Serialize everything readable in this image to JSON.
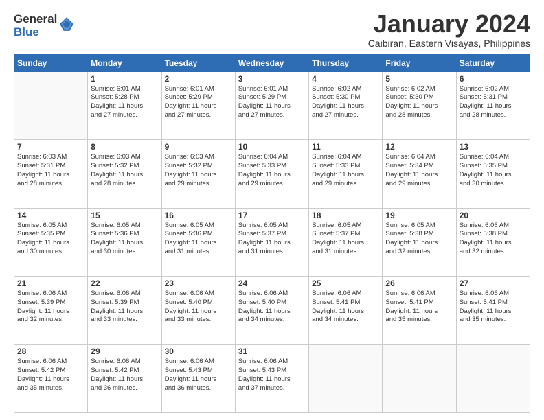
{
  "logo": {
    "general": "General",
    "blue": "Blue"
  },
  "title": "January 2024",
  "subtitle": "Caibiran, Eastern Visayas, Philippines",
  "days_header": [
    "Sunday",
    "Monday",
    "Tuesday",
    "Wednesday",
    "Thursday",
    "Friday",
    "Saturday"
  ],
  "weeks": [
    [
      {
        "day": "",
        "info": ""
      },
      {
        "day": "1",
        "info": "Sunrise: 6:01 AM\nSunset: 5:28 PM\nDaylight: 11 hours\nand 27 minutes."
      },
      {
        "day": "2",
        "info": "Sunrise: 6:01 AM\nSunset: 5:29 PM\nDaylight: 11 hours\nand 27 minutes."
      },
      {
        "day": "3",
        "info": "Sunrise: 6:01 AM\nSunset: 5:29 PM\nDaylight: 11 hours\nand 27 minutes."
      },
      {
        "day": "4",
        "info": "Sunrise: 6:02 AM\nSunset: 5:30 PM\nDaylight: 11 hours\nand 27 minutes."
      },
      {
        "day": "5",
        "info": "Sunrise: 6:02 AM\nSunset: 5:30 PM\nDaylight: 11 hours\nand 28 minutes."
      },
      {
        "day": "6",
        "info": "Sunrise: 6:02 AM\nSunset: 5:31 PM\nDaylight: 11 hours\nand 28 minutes."
      }
    ],
    [
      {
        "day": "7",
        "info": "Sunrise: 6:03 AM\nSunset: 5:31 PM\nDaylight: 11 hours\nand 28 minutes."
      },
      {
        "day": "8",
        "info": "Sunrise: 6:03 AM\nSunset: 5:32 PM\nDaylight: 11 hours\nand 28 minutes."
      },
      {
        "day": "9",
        "info": "Sunrise: 6:03 AM\nSunset: 5:32 PM\nDaylight: 11 hours\nand 29 minutes."
      },
      {
        "day": "10",
        "info": "Sunrise: 6:04 AM\nSunset: 5:33 PM\nDaylight: 11 hours\nand 29 minutes."
      },
      {
        "day": "11",
        "info": "Sunrise: 6:04 AM\nSunset: 5:33 PM\nDaylight: 11 hours\nand 29 minutes."
      },
      {
        "day": "12",
        "info": "Sunrise: 6:04 AM\nSunset: 5:34 PM\nDaylight: 11 hours\nand 29 minutes."
      },
      {
        "day": "13",
        "info": "Sunrise: 6:04 AM\nSunset: 5:35 PM\nDaylight: 11 hours\nand 30 minutes."
      }
    ],
    [
      {
        "day": "14",
        "info": "Sunrise: 6:05 AM\nSunset: 5:35 PM\nDaylight: 11 hours\nand 30 minutes."
      },
      {
        "day": "15",
        "info": "Sunrise: 6:05 AM\nSunset: 5:36 PM\nDaylight: 11 hours\nand 30 minutes."
      },
      {
        "day": "16",
        "info": "Sunrise: 6:05 AM\nSunset: 5:36 PM\nDaylight: 11 hours\nand 31 minutes."
      },
      {
        "day": "17",
        "info": "Sunrise: 6:05 AM\nSunset: 5:37 PM\nDaylight: 11 hours\nand 31 minutes."
      },
      {
        "day": "18",
        "info": "Sunrise: 6:05 AM\nSunset: 5:37 PM\nDaylight: 11 hours\nand 31 minutes."
      },
      {
        "day": "19",
        "info": "Sunrise: 6:05 AM\nSunset: 5:38 PM\nDaylight: 11 hours\nand 32 minutes."
      },
      {
        "day": "20",
        "info": "Sunrise: 6:06 AM\nSunset: 5:38 PM\nDaylight: 11 hours\nand 32 minutes."
      }
    ],
    [
      {
        "day": "21",
        "info": "Sunrise: 6:06 AM\nSunset: 5:39 PM\nDaylight: 11 hours\nand 32 minutes."
      },
      {
        "day": "22",
        "info": "Sunrise: 6:06 AM\nSunset: 5:39 PM\nDaylight: 11 hours\nand 33 minutes."
      },
      {
        "day": "23",
        "info": "Sunrise: 6:06 AM\nSunset: 5:40 PM\nDaylight: 11 hours\nand 33 minutes."
      },
      {
        "day": "24",
        "info": "Sunrise: 6:06 AM\nSunset: 5:40 PM\nDaylight: 11 hours\nand 34 minutes."
      },
      {
        "day": "25",
        "info": "Sunrise: 6:06 AM\nSunset: 5:41 PM\nDaylight: 11 hours\nand 34 minutes."
      },
      {
        "day": "26",
        "info": "Sunrise: 6:06 AM\nSunset: 5:41 PM\nDaylight: 11 hours\nand 35 minutes."
      },
      {
        "day": "27",
        "info": "Sunrise: 6:06 AM\nSunset: 5:41 PM\nDaylight: 11 hours\nand 35 minutes."
      }
    ],
    [
      {
        "day": "28",
        "info": "Sunrise: 6:06 AM\nSunset: 5:42 PM\nDaylight: 11 hours\nand 35 minutes."
      },
      {
        "day": "29",
        "info": "Sunrise: 6:06 AM\nSunset: 5:42 PM\nDaylight: 11 hours\nand 36 minutes."
      },
      {
        "day": "30",
        "info": "Sunrise: 6:06 AM\nSunset: 5:43 PM\nDaylight: 11 hours\nand 36 minutes."
      },
      {
        "day": "31",
        "info": "Sunrise: 6:06 AM\nSunset: 5:43 PM\nDaylight: 11 hours\nand 37 minutes."
      },
      {
        "day": "",
        "info": ""
      },
      {
        "day": "",
        "info": ""
      },
      {
        "day": "",
        "info": ""
      }
    ]
  ]
}
